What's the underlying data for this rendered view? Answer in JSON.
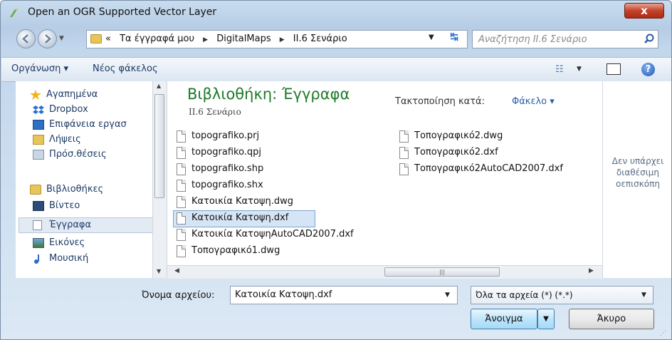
{
  "window": {
    "title": "Open an OGR Supported Vector Layer",
    "close_label": "x"
  },
  "address": {
    "crumbs": [
      "«",
      "Τα έγγραφά μου",
      "DigitalMaps",
      "II.6 Σενάριο"
    ],
    "search_placeholder": "Αναζήτηση II.6 Σενάριο"
  },
  "toolbar": {
    "organize_label": "Οργάνωση ▾",
    "new_folder_label": "Νέος φάκελος"
  },
  "nav": {
    "favorites": [
      "Αγαπημένα",
      "Dropbox",
      "Επιφάνεια εργασ",
      "Λήψεις",
      "Πρόσ.θέσεις"
    ],
    "libraries": [
      "Βιβλιοθήκες",
      "Βίντεο",
      "Έγγραφα",
      "Εικόνες",
      "Μουσική"
    ],
    "selected": "Έγγραφα"
  },
  "content": {
    "library_title": "Βιβλιοθήκη: Έγγραφα",
    "library_subtitle": "II.6 Σενάριο",
    "arrange_label": "Τακτοποίηση κατά:",
    "arrange_value": "Φάκελο ▾",
    "files_col1": [
      "topografiko.prj",
      "topografiko.qpj",
      "topografiko.shp",
      "topografiko.shx",
      "Κατοικία Κατοψη.dwg",
      "Κατοικία Κατοψη.dxf",
      "Κατοικία ΚατοψηAutoCAD2007.dxf",
      "Τοπογραφικό1.dwg"
    ],
    "files_col2": [
      "Τοπογραφικό2.dwg",
      "Τοπογραφικό2.dxf",
      "Τοπογραφικό2AutoCAD2007.dxf"
    ],
    "selected_file": "Κατοικία Κατοψη.dxf"
  },
  "preview": {
    "text": "Δεν υπάρχει διαθέσιμη οεπισκόπη"
  },
  "footer": {
    "filename_label": "Όνομα αρχείου:",
    "filename_value": "Κατοικία Κατοψη.dxf",
    "filter_value": "Όλα τα αρχεία (*) (*.*)",
    "open_label": "Άνοιγμα",
    "cancel_label": "Άκυρο"
  },
  "colors": {
    "library_title": "#1e7a2a",
    "link": "#2c5fa8",
    "selection": "#d6e5f6"
  }
}
